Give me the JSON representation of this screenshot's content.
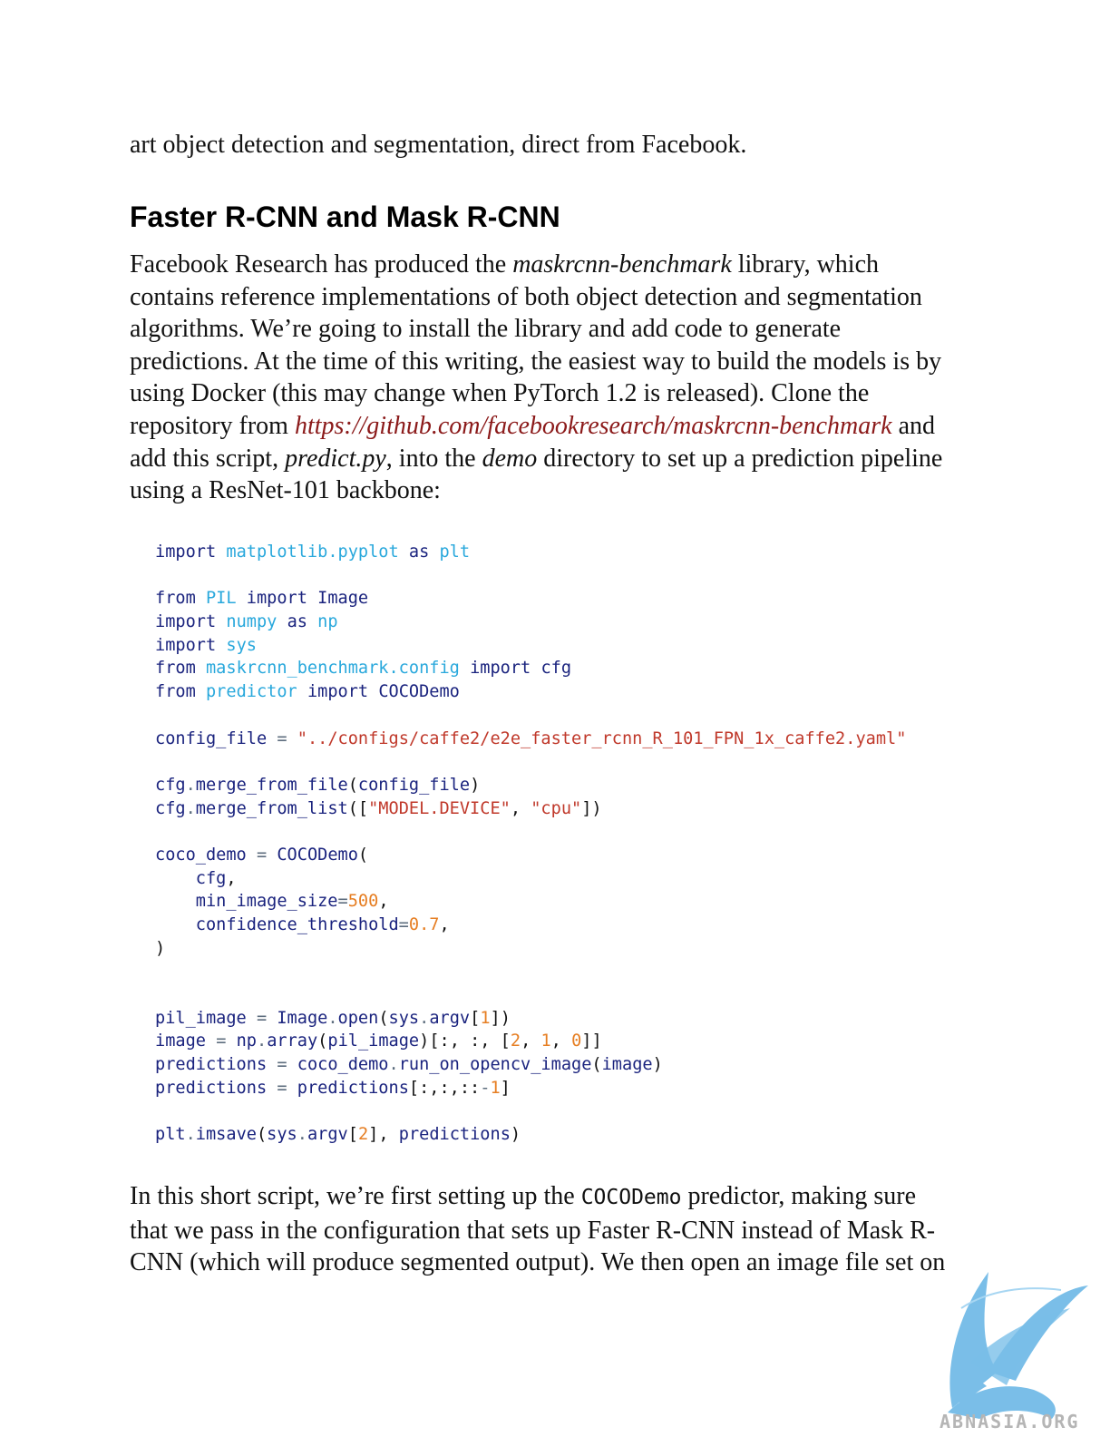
{
  "intro": "art object detection and segmentation, direct from Facebook.",
  "heading": "Faster R-CNN and Mask R-CNN",
  "paragraph1": {
    "lines": [
      [
        {
          "t": "Facebook Research has produced the ",
          "s": "plain"
        },
        {
          "t": "maskrcnn-benchmark",
          "s": "emph"
        },
        {
          "t": " library, which",
          "s": "plain"
        }
      ],
      [
        {
          "t": "contains reference implementations of both object detection and segmentation",
          "s": "plain"
        }
      ],
      [
        {
          "t": "algorithms. We’re going to install the library and add code to generate",
          "s": "plain"
        }
      ],
      [
        {
          "t": "predictions. At the time of this writing, the easiest way to build the models is by",
          "s": "plain"
        }
      ],
      [
        {
          "t": "using Docker (this may change when PyTorch 1.2 is released). Clone the",
          "s": "plain"
        }
      ],
      [
        {
          "t": "repository from ",
          "s": "plain"
        },
        {
          "t": "https://github.com/facebookresearch/maskrcnn-benchmark",
          "s": "link"
        },
        {
          "t": " and",
          "s": "plain"
        }
      ],
      [
        {
          "t": "add this script, ",
          "s": "plain"
        },
        {
          "t": "predict.py",
          "s": "emph"
        },
        {
          "t": ", into the ",
          "s": "plain"
        },
        {
          "t": "demo",
          "s": "emph"
        },
        {
          "t": " directory to set up a prediction pipeline",
          "s": "plain"
        }
      ],
      [
        {
          "t": "using a ResNet-101 backbone:",
          "s": "plain"
        }
      ]
    ]
  },
  "code": [
    [
      {
        "t": "import",
        "k": "kw"
      },
      {
        "t": " ",
        "k": "punct"
      },
      {
        "t": "matplotlib.pyplot",
        "k": "mod"
      },
      {
        "t": " ",
        "k": "punct"
      },
      {
        "t": "as",
        "k": "kw"
      },
      {
        "t": " ",
        "k": "punct"
      },
      {
        "t": "plt",
        "k": "mod"
      }
    ],
    [],
    [
      {
        "t": "from",
        "k": "kw"
      },
      {
        "t": " ",
        "k": "punct"
      },
      {
        "t": "PIL",
        "k": "mod"
      },
      {
        "t": " ",
        "k": "punct"
      },
      {
        "t": "import",
        "k": "kw"
      },
      {
        "t": " ",
        "k": "punct"
      },
      {
        "t": "Image",
        "k": "id"
      }
    ],
    [
      {
        "t": "import",
        "k": "kw"
      },
      {
        "t": " ",
        "k": "punct"
      },
      {
        "t": "numpy",
        "k": "mod"
      },
      {
        "t": " ",
        "k": "punct"
      },
      {
        "t": "as",
        "k": "kw"
      },
      {
        "t": " ",
        "k": "punct"
      },
      {
        "t": "np",
        "k": "mod"
      }
    ],
    [
      {
        "t": "import",
        "k": "kw"
      },
      {
        "t": " ",
        "k": "punct"
      },
      {
        "t": "sys",
        "k": "mod"
      }
    ],
    [
      {
        "t": "from",
        "k": "kw"
      },
      {
        "t": " ",
        "k": "punct"
      },
      {
        "t": "maskrcnn_benchmark.config",
        "k": "mod"
      },
      {
        "t": " ",
        "k": "punct"
      },
      {
        "t": "import",
        "k": "kw"
      },
      {
        "t": " ",
        "k": "punct"
      },
      {
        "t": "cfg",
        "k": "id"
      }
    ],
    [
      {
        "t": "from",
        "k": "kw"
      },
      {
        "t": " ",
        "k": "punct"
      },
      {
        "t": "predictor",
        "k": "mod"
      },
      {
        "t": " ",
        "k": "punct"
      },
      {
        "t": "import",
        "k": "kw"
      },
      {
        "t": " ",
        "k": "punct"
      },
      {
        "t": "COCODemo",
        "k": "id"
      }
    ],
    [],
    [
      {
        "t": "config_file",
        "k": "id"
      },
      {
        "t": " ",
        "k": "punct"
      },
      {
        "t": "=",
        "k": "op"
      },
      {
        "t": " ",
        "k": "punct"
      },
      {
        "t": "\"../configs/caffe2/e2e_faster_rcnn_R_101_FPN_1x_caffe2.yaml\"",
        "k": "str"
      }
    ],
    [],
    [
      {
        "t": "cfg",
        "k": "id"
      },
      {
        "t": ".",
        "k": "op"
      },
      {
        "t": "merge_from_file",
        "k": "id"
      },
      {
        "t": "(",
        "k": "punct"
      },
      {
        "t": "config_file",
        "k": "id"
      },
      {
        "t": ")",
        "k": "punct"
      }
    ],
    [
      {
        "t": "cfg",
        "k": "id"
      },
      {
        "t": ".",
        "k": "op"
      },
      {
        "t": "merge_from_list",
        "k": "id"
      },
      {
        "t": "([",
        "k": "punct"
      },
      {
        "t": "\"MODEL.DEVICE\"",
        "k": "str"
      },
      {
        "t": ", ",
        "k": "punct"
      },
      {
        "t": "\"cpu\"",
        "k": "str"
      },
      {
        "t": "])",
        "k": "punct"
      }
    ],
    [],
    [
      {
        "t": "coco_demo",
        "k": "id"
      },
      {
        "t": " ",
        "k": "punct"
      },
      {
        "t": "=",
        "k": "op"
      },
      {
        "t": " ",
        "k": "punct"
      },
      {
        "t": "COCODemo",
        "k": "id"
      },
      {
        "t": "(",
        "k": "punct"
      }
    ],
    [
      {
        "t": "    ",
        "k": "punct"
      },
      {
        "t": "cfg",
        "k": "id"
      },
      {
        "t": ",",
        "k": "punct"
      }
    ],
    [
      {
        "t": "    ",
        "k": "punct"
      },
      {
        "t": "min_image_size",
        "k": "id"
      },
      {
        "t": "=",
        "k": "op"
      },
      {
        "t": "500",
        "k": "num"
      },
      {
        "t": ",",
        "k": "punct"
      }
    ],
    [
      {
        "t": "    ",
        "k": "punct"
      },
      {
        "t": "confidence_threshold",
        "k": "id"
      },
      {
        "t": "=",
        "k": "op"
      },
      {
        "t": "0.7",
        "k": "num"
      },
      {
        "t": ",",
        "k": "punct"
      }
    ],
    [
      {
        "t": ")",
        "k": "punct"
      }
    ],
    [],
    [],
    [
      {
        "t": "pil_image",
        "k": "id"
      },
      {
        "t": " ",
        "k": "punct"
      },
      {
        "t": "=",
        "k": "op"
      },
      {
        "t": " ",
        "k": "punct"
      },
      {
        "t": "Image",
        "k": "id"
      },
      {
        "t": ".",
        "k": "op"
      },
      {
        "t": "open",
        "k": "id"
      },
      {
        "t": "(",
        "k": "punct"
      },
      {
        "t": "sys",
        "k": "id"
      },
      {
        "t": ".",
        "k": "op"
      },
      {
        "t": "argv",
        "k": "id"
      },
      {
        "t": "[",
        "k": "punct"
      },
      {
        "t": "1",
        "k": "num"
      },
      {
        "t": "])",
        "k": "punct"
      }
    ],
    [
      {
        "t": "image",
        "k": "id"
      },
      {
        "t": " ",
        "k": "punct"
      },
      {
        "t": "=",
        "k": "op"
      },
      {
        "t": " ",
        "k": "punct"
      },
      {
        "t": "np",
        "k": "id"
      },
      {
        "t": ".",
        "k": "op"
      },
      {
        "t": "array",
        "k": "id"
      },
      {
        "t": "(",
        "k": "punct"
      },
      {
        "t": "pil_image",
        "k": "id"
      },
      {
        "t": ")[:, :, [",
        "k": "punct"
      },
      {
        "t": "2",
        "k": "num"
      },
      {
        "t": ", ",
        "k": "punct"
      },
      {
        "t": "1",
        "k": "num"
      },
      {
        "t": ", ",
        "k": "punct"
      },
      {
        "t": "0",
        "k": "num"
      },
      {
        "t": "]]",
        "k": "punct"
      }
    ],
    [
      {
        "t": "predictions",
        "k": "id"
      },
      {
        "t": " ",
        "k": "punct"
      },
      {
        "t": "=",
        "k": "op"
      },
      {
        "t": " ",
        "k": "punct"
      },
      {
        "t": "coco_demo",
        "k": "id"
      },
      {
        "t": ".",
        "k": "op"
      },
      {
        "t": "run_on_opencv_image",
        "k": "id"
      },
      {
        "t": "(",
        "k": "punct"
      },
      {
        "t": "image",
        "k": "id"
      },
      {
        "t": ")",
        "k": "punct"
      }
    ],
    [
      {
        "t": "predictions",
        "k": "id"
      },
      {
        "t": " ",
        "k": "punct"
      },
      {
        "t": "=",
        "k": "op"
      },
      {
        "t": " ",
        "k": "punct"
      },
      {
        "t": "predictions",
        "k": "id"
      },
      {
        "t": "[:,:,::",
        "k": "punct"
      },
      {
        "t": "-",
        "k": "op"
      },
      {
        "t": "1",
        "k": "num"
      },
      {
        "t": "]",
        "k": "punct"
      }
    ],
    [],
    [
      {
        "t": "plt",
        "k": "id"
      },
      {
        "t": ".",
        "k": "op"
      },
      {
        "t": "imsave",
        "k": "id"
      },
      {
        "t": "(",
        "k": "punct"
      },
      {
        "t": "sys",
        "k": "id"
      },
      {
        "t": ".",
        "k": "op"
      },
      {
        "t": "argv",
        "k": "id"
      },
      {
        "t": "[",
        "k": "punct"
      },
      {
        "t": "2",
        "k": "num"
      },
      {
        "t": "], ",
        "k": "punct"
      },
      {
        "t": "predictions",
        "k": "id"
      },
      {
        "t": ")",
        "k": "punct"
      }
    ]
  ],
  "paragraph2": {
    "lines": [
      [
        {
          "t": "In this short script, we’re first setting up the ",
          "s": "plain"
        },
        {
          "t": "COCODemo",
          "s": "code"
        },
        {
          "t": " predictor, making sure",
          "s": "plain"
        }
      ],
      [
        {
          "t": "that we pass in the configuration that sets up Faster R-CNN instead of Mask R-",
          "s": "plain"
        }
      ],
      [
        {
          "t": "CNN (which will produce segmented output). We then open an image file set on",
          "s": "plain"
        }
      ]
    ]
  },
  "watermark": {
    "text": "ABNASIA.ORG",
    "logo_icon": "griffin-logo-icon",
    "color": "#6cb8e6"
  }
}
